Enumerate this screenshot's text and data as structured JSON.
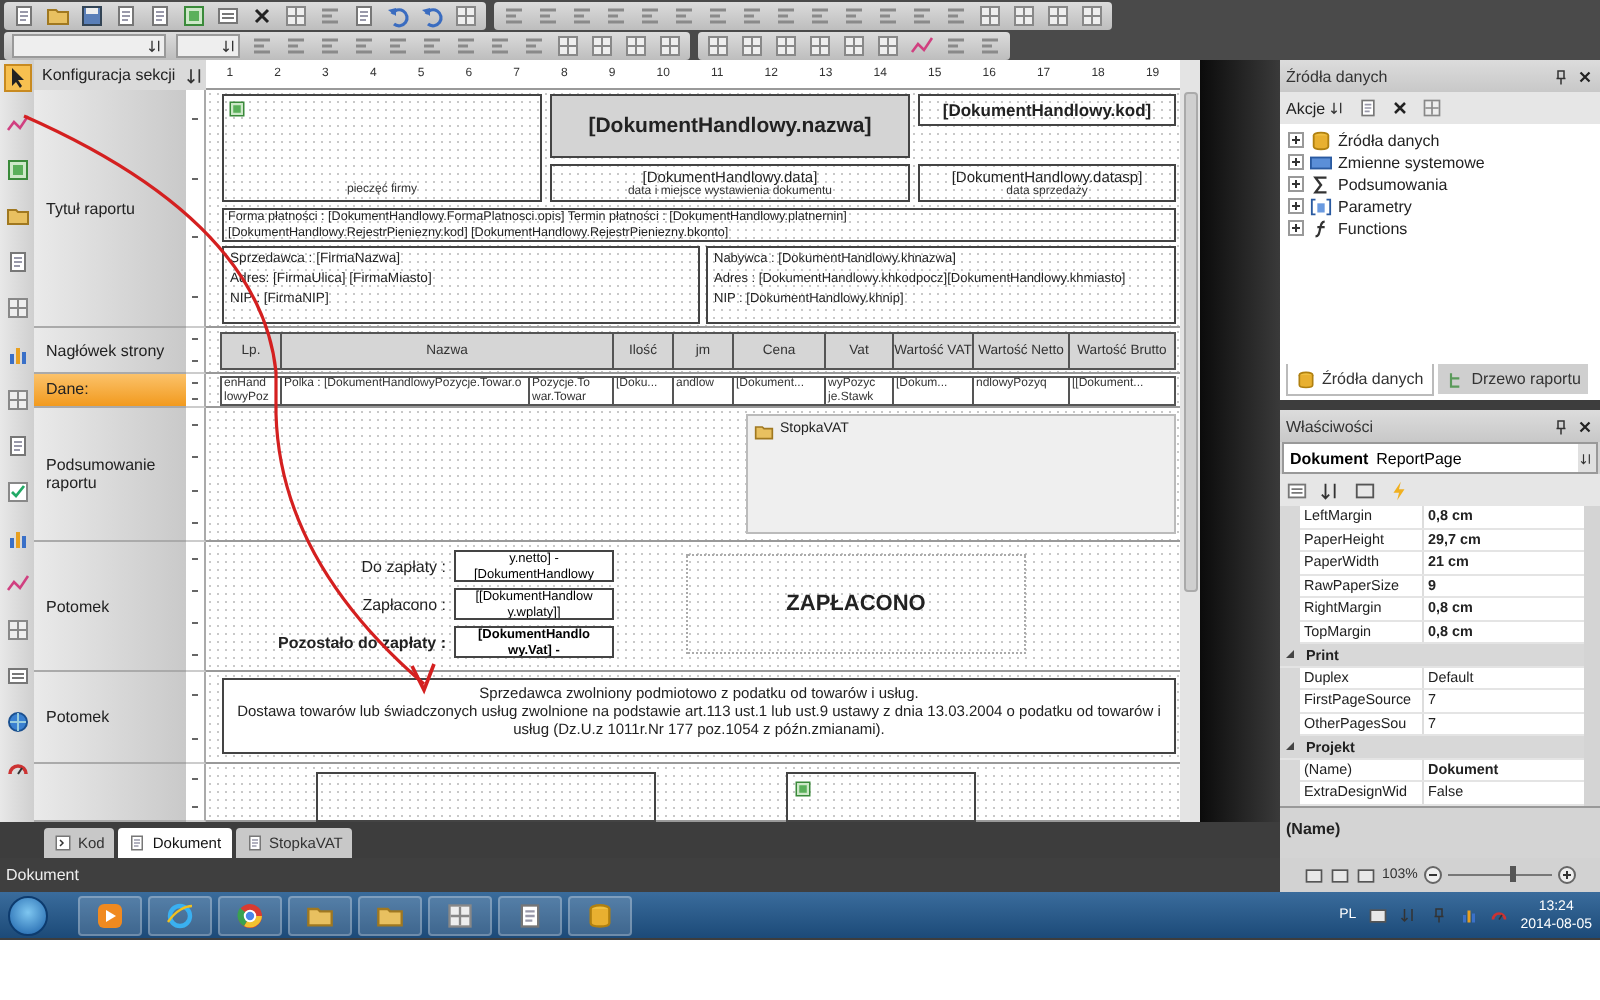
{
  "toolbox": {
    "tools": [
      {
        "selected": true
      },
      {
        "selected": false
      },
      {
        "selected": false
      },
      {
        "selected": false
      },
      {
        "selected": false
      },
      {
        "selected": false
      },
      {
        "selected": false
      },
      {
        "selected": false
      },
      {
        "selected": false
      },
      {
        "selected": false
      },
      {
        "selected": false
      },
      {
        "selected": false
      },
      {
        "selected": false
      },
      {
        "selected": false
      },
      {
        "selected": false
      },
      {
        "selected": false
      }
    ]
  },
  "section_config": "Konfiguracja sekcji",
  "ruler": [
    "1",
    "2",
    "3",
    "4",
    "5",
    "6",
    "7",
    "8",
    "9",
    "10",
    "11",
    "12",
    "13",
    "14",
    "15",
    "16",
    "17",
    "18",
    "19"
  ],
  "sections": [
    {
      "label": "Tytuł raportu",
      "selected": false
    },
    {
      "label": "Nagłówek strony",
      "selected": false
    },
    {
      "label": "Dane:",
      "selected": true
    },
    {
      "label": "Podsumowanie raportu",
      "selected": false
    },
    {
      "label": "Potomek",
      "selected": false
    },
    {
      "label": "Potomek",
      "selected": false
    },
    {
      "selected": false
    }
  ],
  "report": {
    "stamp_caption": "pieczęć firmy",
    "title": "[DokumentHandlowy.nazwa]",
    "code": "[DokumentHandlowy.kod]",
    "date": "[DokumentHandlowy.data]",
    "date_caption": "data i miejsce wystawienia dokumentu",
    "sale_date": "[DokumentHandlowy.datasp]",
    "sale_date_caption": "data sprzedaży",
    "payment_lines": [
      "Forma płatności : [DokumentHandlowy.FormaPlatnosci.opis] Termin płatności : [DokumentHandlowy.platnernin]",
      "[DokumentHandlowy.RejestrPieniezny.kod] [DokumentHandlowy.RejestrPieniezny.bkonto]"
    ],
    "seller_lines": [
      "Sprzedawca : [FirmaNazwa]",
      "Adres: [FirmaUlica] [FirmaMiasto]",
      "NIP : [FirmaNIP]"
    ],
    "buyer_lines": [
      "Nabywca : [DokumentHandlowy.khnazwa]",
      "Adres : [DokumentHandlowy.khkodpocz][DokumentHandlowy.khmiasto]",
      "NIP : [DokumentHandlowy.khnip]"
    ],
    "columns": [
      "Lp.",
      "Nazwa",
      "Ilość",
      "jm",
      "Cena",
      "Vat",
      "Wartość VAT",
      "Wartość Netto",
      "Wartość Brutto"
    ],
    "row": [
      "enHand lowyPoz",
      "Polka : [DokumentHandlowyPozycje.Towar.o",
      "Pozycje.To war.Towar",
      "[Doku...",
      "andlow",
      "[Dokument...",
      "wyPozyc je.Stawk",
      "[Dokum...",
      "ndlowyPozyq",
      "[[Dokument..."
    ],
    "subreport": "StopkaVAT",
    "totals": [
      {
        "label": "Do zapłaty :",
        "value": "y.netto] -[DokumentHandlowy",
        "bold": false
      },
      {
        "label": "Zapłacono :",
        "value": "[[DokumentHandlow y.wplaty]]",
        "bold": false
      },
      {
        "label": "Pozostało do zapłaty :",
        "value": "[DokumentHandlo wy.Vat] -",
        "bold": true
      }
    ],
    "paid_stamp": "ZAPŁACONO",
    "note_lines": [
      "Sprzedawca zwolniony podmiotowo z podatku od towarów i usług.",
      "Dostawa towarów lub świadczonych usług zwolnione na  podstawie art.113 ust.1 lub ust.9 ustawy z dnia 13.03.2004 o podatku od towarów i usług (Dz.U.z 1011r.Nr 177 poz.1054 z późn.zmianami)."
    ]
  },
  "doc_tabs": [
    {
      "label": "Kod",
      "selected": false
    },
    {
      "label": "Dokument",
      "selected": true
    },
    {
      "label": "StopkaVAT",
      "selected": false
    }
  ],
  "data_sources": {
    "title": "Źródła danych",
    "actions": "Akcje",
    "tree": [
      {
        "label": "Źródła danych",
        "expanded": false
      },
      {
        "label": "Zmienne systemowe",
        "expanded": false
      },
      {
        "label": "Podsumowania",
        "expanded": false
      },
      {
        "label": "Parametry",
        "expanded": false
      },
      {
        "label": "Functions",
        "expanded": false
      }
    ],
    "tabs": [
      {
        "label": "Źródła danych",
        "selected": true
      },
      {
        "label": "Drzewo raportu",
        "selected": false
      }
    ]
  },
  "properties": {
    "title": "Właściwości",
    "object": "Dokument",
    "object_type": "ReportPage",
    "rows": [
      {
        "kind": "property",
        "name": "LeftMargin",
        "value": "0,8 cm",
        "modified": true
      },
      {
        "kind": "property",
        "name": "PaperHeight",
        "value": "29,7 cm",
        "modified": true
      },
      {
        "kind": "property",
        "name": "PaperWidth",
        "value": "21 cm",
        "modified": true
      },
      {
        "kind": "property",
        "name": "RawPaperSize",
        "value": "9",
        "modified": true
      },
      {
        "kind": "property",
        "name": "RightMargin",
        "value": "0,8 cm",
        "modified": true
      },
      {
        "kind": "property",
        "name": "TopMargin",
        "value": "0,8 cm",
        "modified": true
      },
      {
        "kind": "category",
        "name": "Print",
        "expanded": true
      },
      {
        "kind": "property",
        "name": "Duplex",
        "value": "Default",
        "modified": false
      },
      {
        "kind": "property",
        "name": "FirstPageSource",
        "value": "7",
        "modified": false
      },
      {
        "kind": "property",
        "name": "OtherPagesSou",
        "value": "7",
        "modified": false
      },
      {
        "kind": "category",
        "name": "Projekt",
        "expanded": true
      },
      {
        "kind": "property",
        "name": "(Name)",
        "value": "Dokument",
        "modified": true
      },
      {
        "kind": "property",
        "name": "ExtraDesignWid",
        "value": "False",
        "modified": false
      }
    ],
    "description": "(Name)"
  },
  "status_bar": {
    "text": "Dokument",
    "zoom": "103%",
    "zoom_slider": {
      "level": 0.62
    }
  },
  "taskbar": {
    "language": "PL",
    "time": "13:24",
    "date": "2014-08-05"
  }
}
